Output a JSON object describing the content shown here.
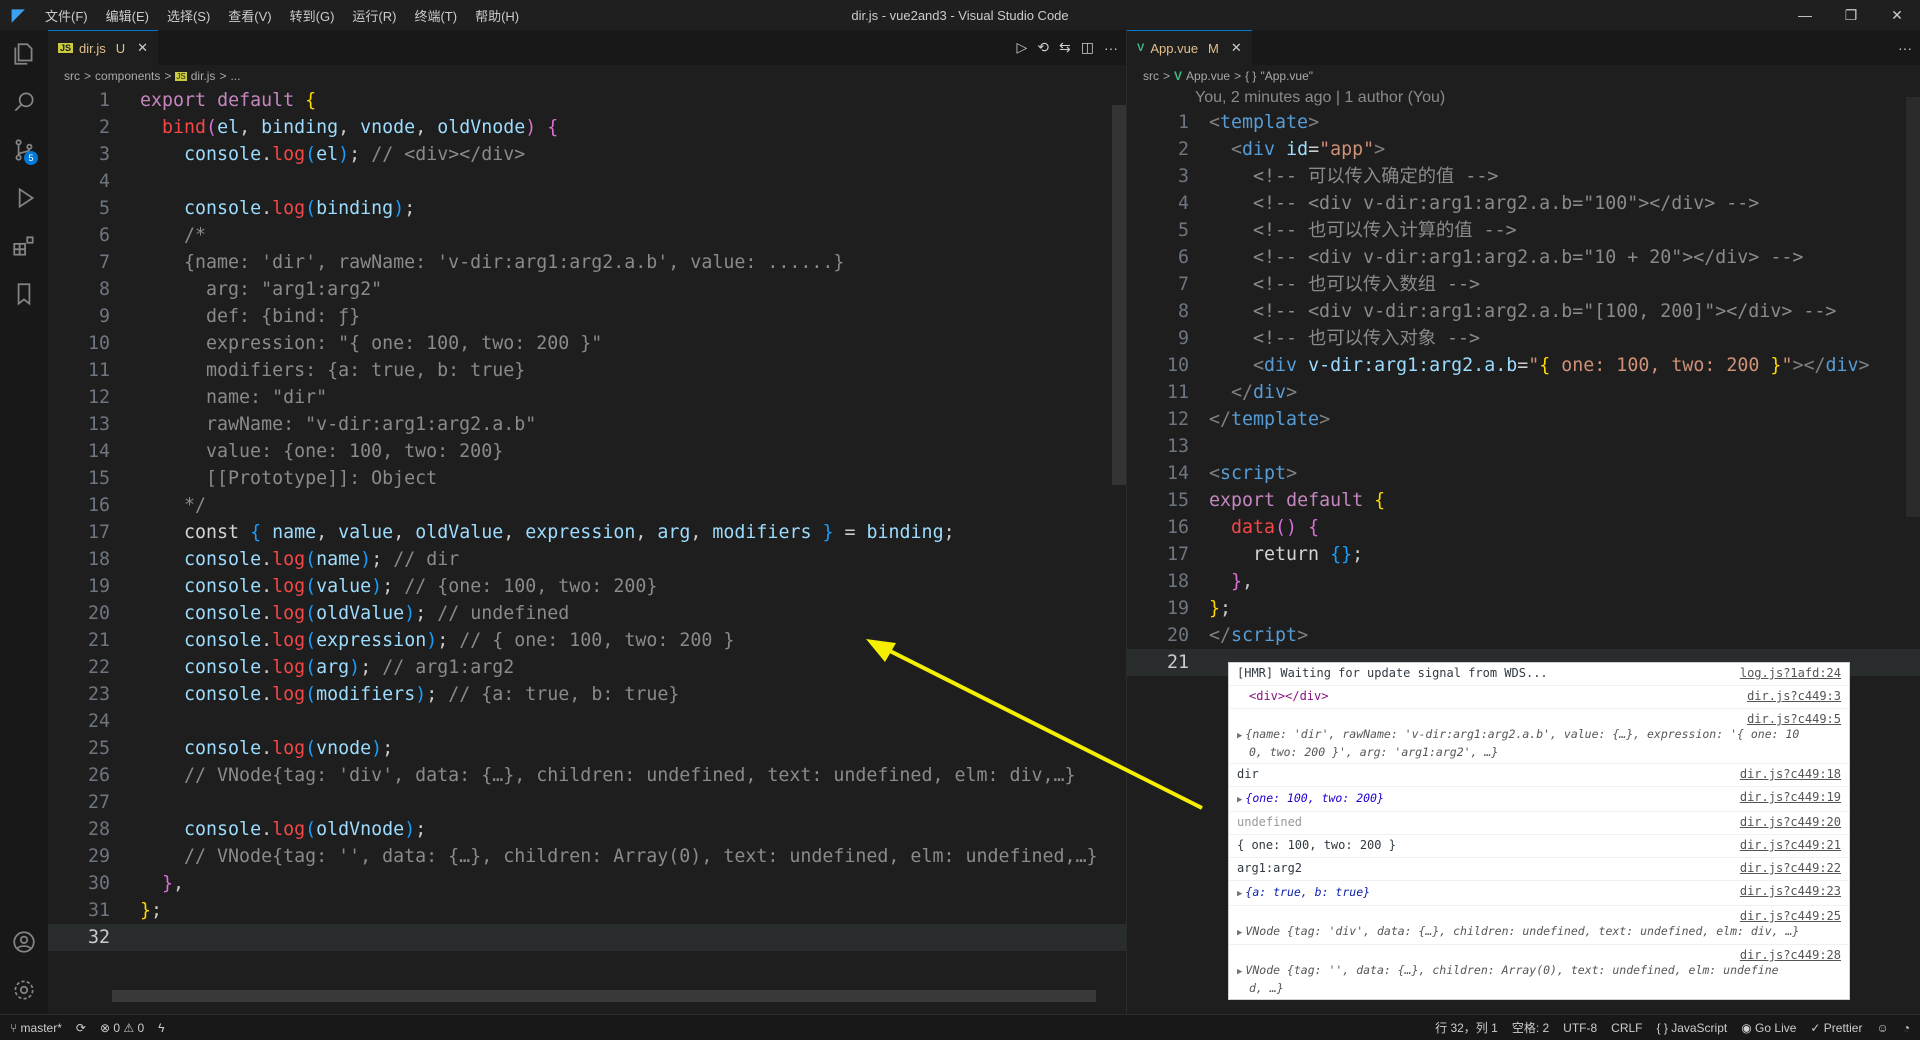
{
  "window": {
    "title": "dir.js - vue2and3 - Visual Studio Code",
    "menu": [
      "文件(F)",
      "编辑(E)",
      "选择(S)",
      "查看(V)",
      "转到(G)",
      "运行(R)",
      "终端(T)",
      "帮助(H)"
    ],
    "controls": {
      "minimize": "—",
      "restore": "❐",
      "close": "✕"
    }
  },
  "activitybar": {
    "icons": [
      "explorer-icon",
      "search-icon",
      "source-control-icon",
      "run-debug-icon",
      "extensions-icon",
      "bookmark-icon"
    ],
    "source_control_badge": "5",
    "bottom_icons": [
      "account-icon",
      "settings-gear-icon"
    ]
  },
  "left_editor": {
    "tab": {
      "file_icon": "JS",
      "name": "dir.js",
      "status": "U",
      "close": "✕"
    },
    "actions": [
      "▷",
      "⟲",
      "⇆",
      "◫",
      "···"
    ],
    "breadcrumb": [
      "src",
      ">",
      "components",
      ">",
      "JS",
      "dir.js",
      ">",
      "..."
    ],
    "line_numbers": [
      "1",
      "2",
      "3",
      "4",
      "5",
      "6",
      "7",
      "8",
      "9",
      "10",
      "11",
      "12",
      "13",
      "14",
      "15",
      "16",
      "17",
      "18",
      "19",
      "20",
      "21",
      "22",
      "23",
      "24",
      "25",
      "26",
      "27",
      "28",
      "29",
      "30",
      "31",
      "32"
    ],
    "active_line": "32"
  },
  "right_editor": {
    "tab": {
      "file_icon": "V",
      "name": "App.vue",
      "status": "M",
      "close": "✕"
    },
    "actions": [
      "···"
    ],
    "breadcrumb": [
      "src",
      ">",
      "V",
      "App.vue",
      ">",
      "{ }",
      "\"App.vue\""
    ],
    "blame": "You, 2 minutes ago | 1 author (You)",
    "line_numbers": [
      "1",
      "2",
      "3",
      "4",
      "5",
      "6",
      "7",
      "8",
      "9",
      "10",
      "11",
      "12",
      "13",
      "14",
      "15",
      "16",
      "17",
      "18",
      "19",
      "20",
      "21"
    ],
    "active_line": "21"
  },
  "console": {
    "rows": [
      {
        "msg": "[HMR] Waiting for update signal from WDS...",
        "link": "log.js?1afd:24"
      },
      {
        "msg": "<div></div>",
        "link": "dir.js?c449:3"
      },
      {
        "link": "dir.js?c449:5",
        "obj_line1": "{name: 'dir', rawName: 'v-dir:arg1:arg2.a.b', value: {…}, expression: '{ one: 10",
        "obj_line2": "0, two: 200 }', arg: 'arg1:arg2', …}"
      },
      {
        "msg": "dir",
        "link": "dir.js?c449:18"
      },
      {
        "obj": "{one: 100, two: 200}",
        "link": "dir.js?c449:19"
      },
      {
        "msg": "undefined",
        "link": "dir.js?c449:20"
      },
      {
        "msg": "{ one: 100, two: 200 }",
        "link": "dir.js?c449:21"
      },
      {
        "msg": "arg1:arg2",
        "link": "dir.js?c449:22"
      },
      {
        "obj": "{a: true, b: true}",
        "link": "dir.js?c449:23"
      },
      {
        "link": "dir.js?c449:25",
        "obj_line1": "VNode {tag: 'div', data: {…}, children: undefined, text: undefined, elm: div, …}"
      },
      {
        "link": "dir.js?c449:28",
        "obj_line1": "VNode {tag: '', data: {…}, children: Array(0), text: undefined, elm: undefine",
        "obj_line2": "d, …}"
      }
    ]
  },
  "statusbar": {
    "branch": "master*",
    "sync": "⟳",
    "problems": "⊗ 0 ⚠ 0",
    "lightning": "ϟ",
    "cursor": "行 32，列 1",
    "spaces": "空格: 2",
    "encoding": "UTF-8",
    "eol": "CRLF",
    "language": "{ } JavaScript",
    "golive": "Go Live",
    "prettier": "✓ Prettier",
    "feedback": "☺",
    "bell": "🔔"
  },
  "colors": {
    "accent": "#0078d4",
    "arrow": "#f5f000",
    "editor_bg": "#1e1e1e"
  }
}
